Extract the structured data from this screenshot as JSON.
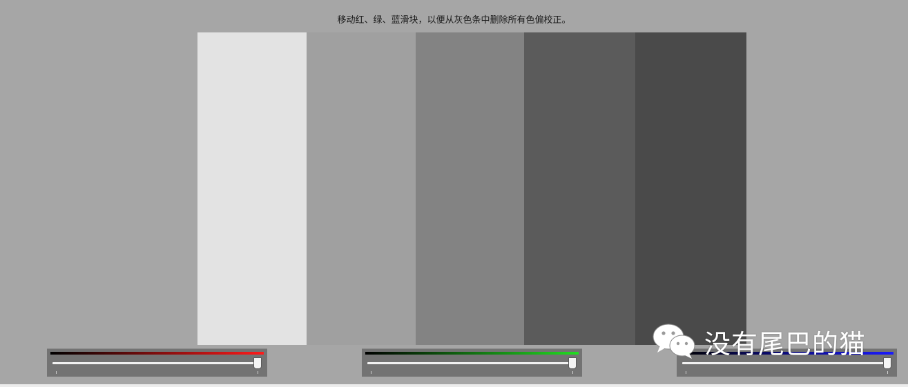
{
  "instruction": "移动红、绿、蓝滑块，以便从灰色条中删除所有色偏校正。",
  "gray_bars": [
    {
      "color": "#e3e3e3"
    },
    {
      "color": "#a0a0a0"
    },
    {
      "color": "#838383"
    },
    {
      "color": "#5b5b5b"
    },
    {
      "color": "#4a4a4a"
    }
  ],
  "sliders": [
    {
      "channel": "red",
      "gradient_end": "#ff1a1a",
      "value_percent": 100
    },
    {
      "channel": "green",
      "gradient_end": "#22dd22",
      "value_percent": 100
    },
    {
      "channel": "blue",
      "gradient_end": "#1a1aff",
      "value_percent": 100
    }
  ],
  "watermark": {
    "icon": "wechat-icon",
    "text": "没有尾巴的猫"
  }
}
